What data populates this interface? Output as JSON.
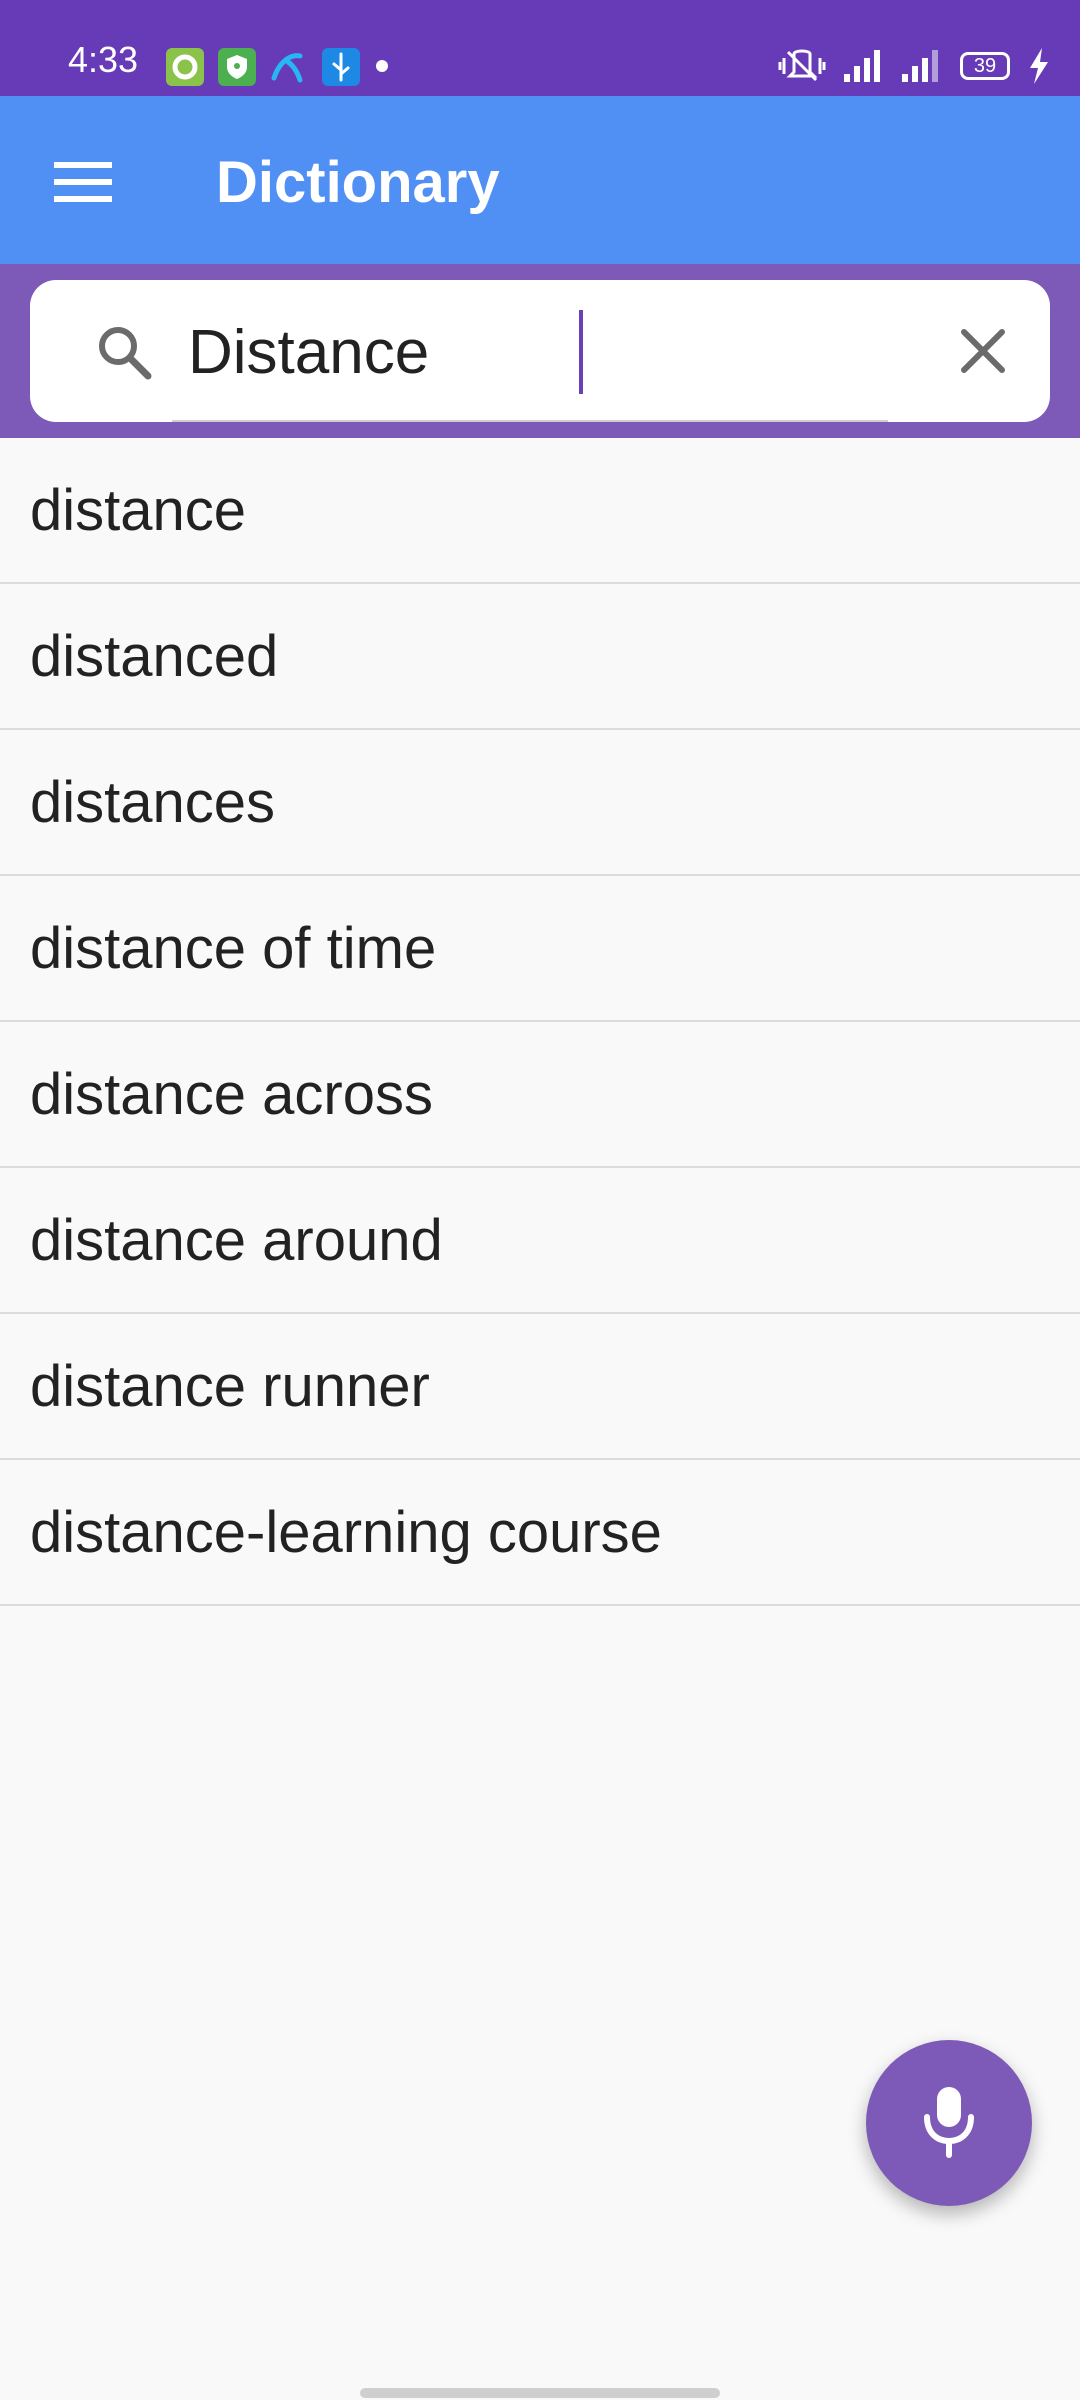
{
  "status_bar": {
    "time": "4:33",
    "battery_level": "39",
    "icons": [
      "app-notification-icon",
      "shield-icon",
      "telenor-icon",
      "usb-icon",
      "vibrate-icon",
      "signal-icon",
      "signal-icon",
      "battery-icon",
      "charging-icon"
    ]
  },
  "app_bar": {
    "title": "Dictionary",
    "menu_icon": "hamburger-menu-icon"
  },
  "search": {
    "value": "Distance",
    "placeholder": "",
    "search_icon": "search-icon",
    "clear_icon": "close-icon"
  },
  "results": [
    "distance",
    "distanced",
    "distances",
    "distance of time",
    "distance across",
    "distance around",
    "distance runner",
    "distance-learning course"
  ],
  "fab": {
    "icon": "microphone-icon"
  },
  "colors": {
    "status_bar": "#673ab7",
    "app_bar": "#508ff4",
    "search_band": "#7e5ab8",
    "fab": "#7e5ab8",
    "background": "#f9f9f9"
  }
}
